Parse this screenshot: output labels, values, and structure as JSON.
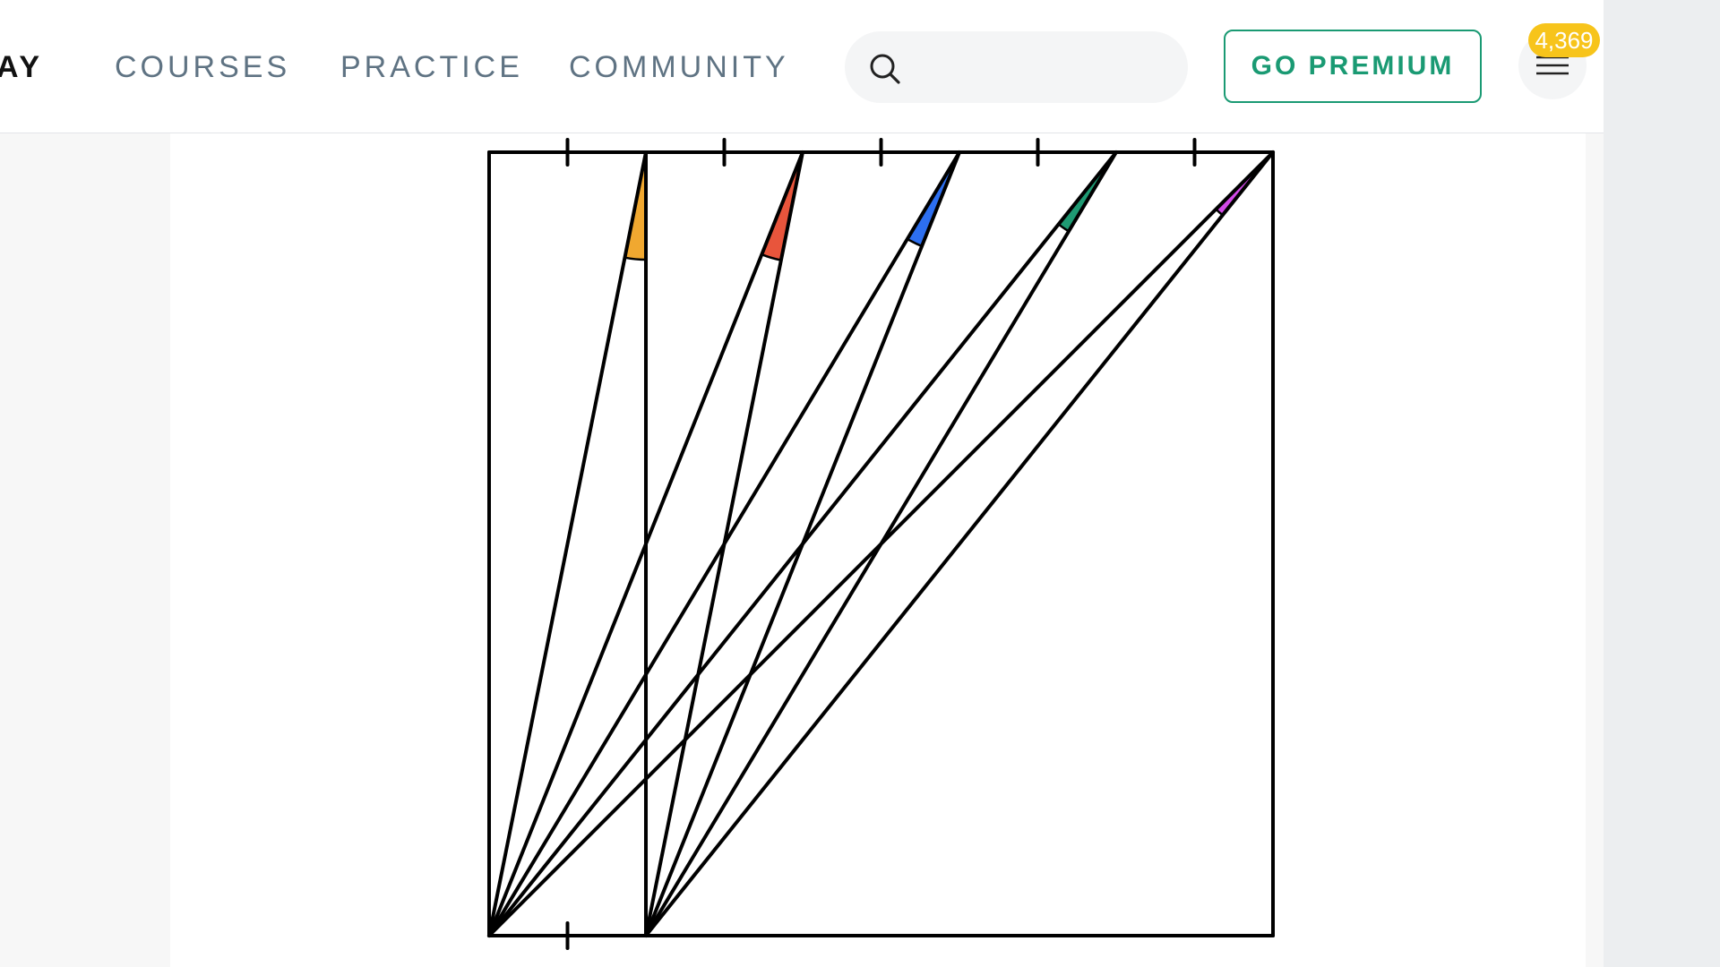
{
  "nav": {
    "items": [
      {
        "label": "AY",
        "active": true
      },
      {
        "label": "COURSES",
        "active": false
      },
      {
        "label": "PRACTICE",
        "active": false
      },
      {
        "label": "COMMUNITY",
        "active": false
      }
    ]
  },
  "search": {
    "placeholder": "",
    "value": "",
    "icon": "search-icon"
  },
  "premium": {
    "label": "GO PREMIUM",
    "color": "#1a9a73"
  },
  "menu": {
    "icon": "hamburger-icon",
    "badge": "4,369",
    "badge_color": "#f7c41b"
  },
  "diagram": {
    "colors": {
      "stroke": "#000000",
      "wedges": [
        "#f0a830",
        "#e8553c",
        "#2d6ff0",
        "#1f9a73",
        "#d24ae8"
      ]
    }
  }
}
